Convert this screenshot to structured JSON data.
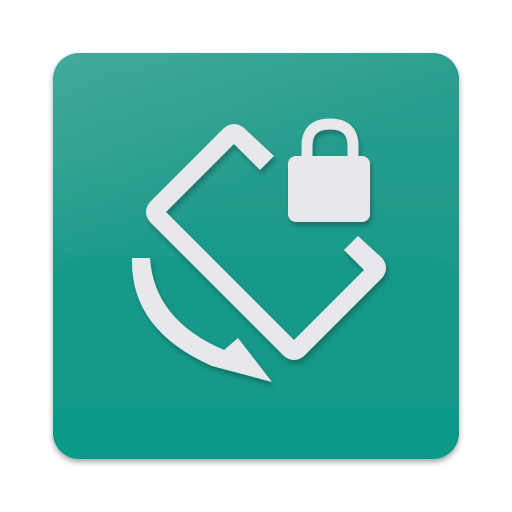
{
  "icon": {
    "name": "screen-rotation-lock-icon",
    "colors": {
      "tile_top": "#2a9e8f",
      "tile_bottom": "#109a88",
      "tile_shadow": "#7a8a88",
      "glyph": "#e7e8ec",
      "glyph_shadow": "#0b5f55"
    }
  }
}
